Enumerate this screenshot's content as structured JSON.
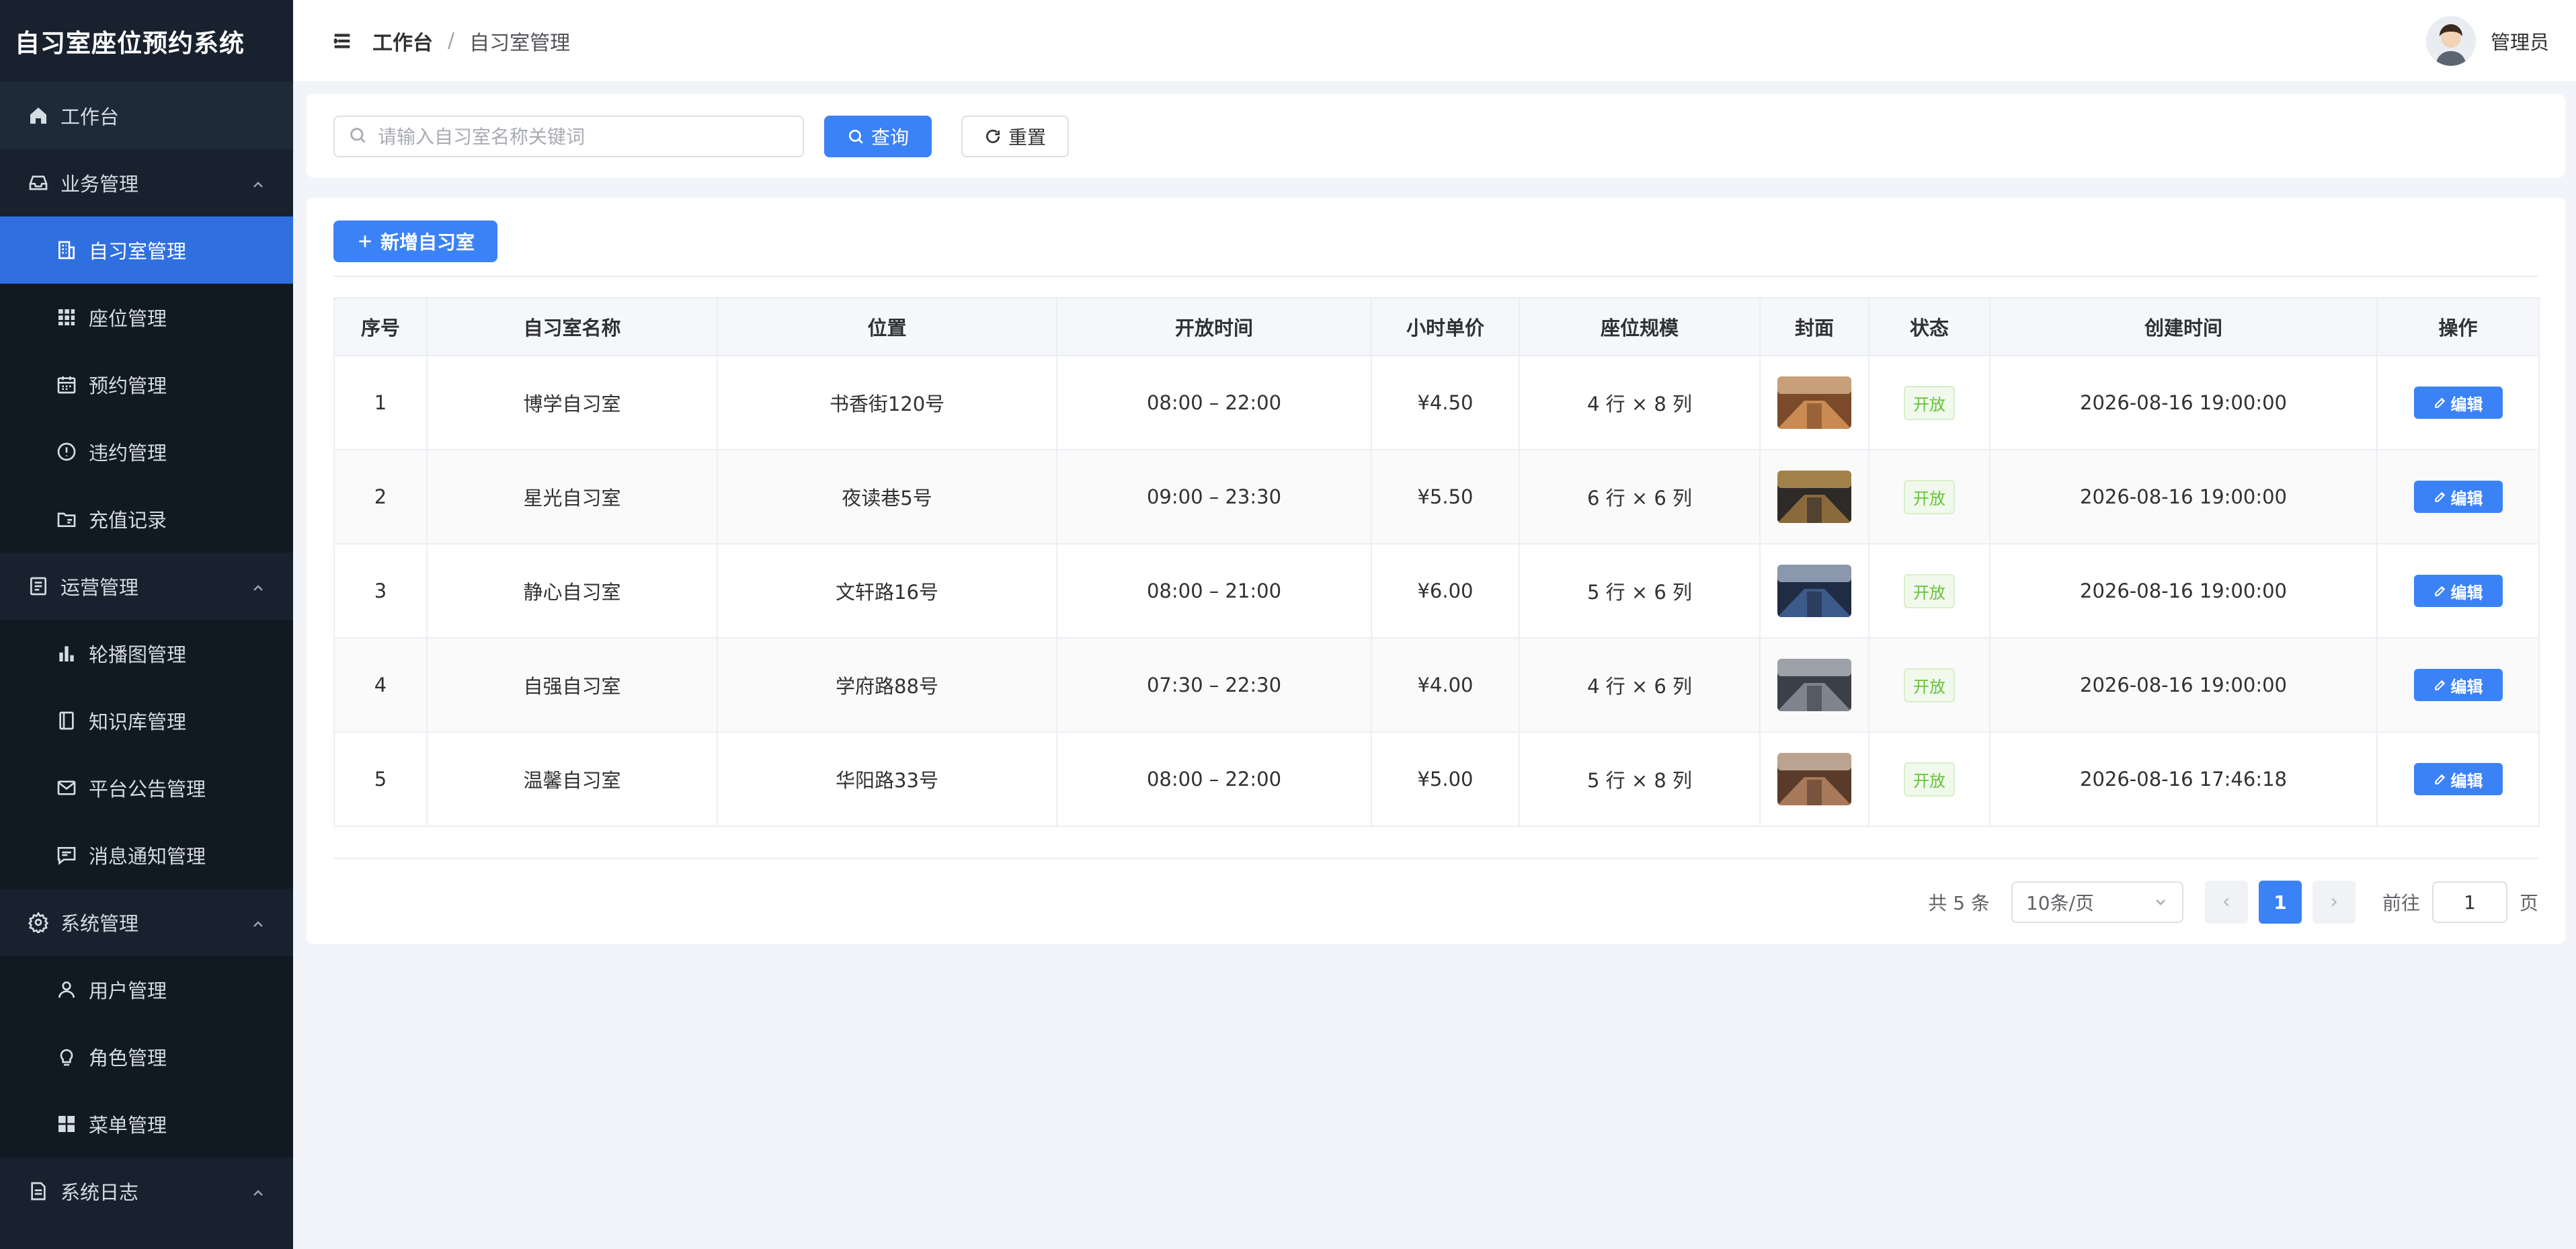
{
  "app": {
    "title": "自习室座位预约系统"
  },
  "sidebar": {
    "home": {
      "label": "工作台",
      "icon": "home-icon"
    },
    "groups": [
      {
        "label": "业务管理",
        "icon": "inbox-icon",
        "items": [
          {
            "label": "自习室管理",
            "icon": "building-icon",
            "active": true
          },
          {
            "label": "座位管理",
            "icon": "grid-icon"
          },
          {
            "label": "预约管理",
            "icon": "calendar-icon"
          },
          {
            "label": "违约管理",
            "icon": "alert-circle-icon"
          },
          {
            "label": "充值记录",
            "icon": "folder-icon"
          }
        ]
      },
      {
        "label": "运营管理",
        "icon": "document-icon",
        "items": [
          {
            "label": "轮播图管理",
            "icon": "bar-chart-icon"
          },
          {
            "label": "知识库管理",
            "icon": "book-icon"
          },
          {
            "label": "平台公告管理",
            "icon": "mail-icon"
          },
          {
            "label": "消息通知管理",
            "icon": "message-icon"
          }
        ]
      },
      {
        "label": "系统管理",
        "icon": "gear-icon",
        "items": [
          {
            "label": "用户管理",
            "icon": "user-icon"
          },
          {
            "label": "角色管理",
            "icon": "bulb-icon"
          },
          {
            "label": "菜单管理",
            "icon": "grid-icon"
          }
        ]
      },
      {
        "label": "系统日志",
        "icon": "file-icon",
        "items": []
      }
    ]
  },
  "header": {
    "breadcrumb": [
      "工作台",
      "自习室管理"
    ],
    "breadcrumb_sep": "/",
    "user_name": "管理员"
  },
  "search": {
    "placeholder": "请输入自习室名称关键词",
    "value": "",
    "query_label": "查询",
    "reset_label": "重置"
  },
  "toolbar": {
    "add_label": "新增自习室"
  },
  "table": {
    "columns": [
      "序号",
      "自习室名称",
      "位置",
      "开放时间",
      "小时单价",
      "座位规模",
      "封面",
      "状态",
      "创建时间",
      "操作"
    ],
    "rows": [
      {
        "no": "1",
        "name": "博学自习室",
        "location": "书香街120号",
        "hours": "08:00 – 22:00",
        "price": "¥4.50",
        "scale": "4 行 × 8 列",
        "status": "开放",
        "created": "2026-08-16 19:00:00",
        "action": "编辑",
        "cover_colors": [
          "#7a4a2a",
          "#c98b52",
          "#e8c39a"
        ]
      },
      {
        "no": "2",
        "name": "星光自习室",
        "location": "夜读巷5号",
        "hours": "09:00 – 23:30",
        "price": "¥5.50",
        "scale": "6 行 × 6 列",
        "status": "开放",
        "created": "2026-08-16 19:00:00",
        "action": "编辑",
        "cover_colors": [
          "#2d2a28",
          "#8a6a3c",
          "#d6a65a"
        ]
      },
      {
        "no": "3",
        "name": "静心自习室",
        "location": "文轩路16号",
        "hours": "08:00 – 21:00",
        "price": "¥6.00",
        "scale": "5 行 × 6 列",
        "status": "开放",
        "created": "2026-08-16 19:00:00",
        "action": "编辑",
        "cover_colors": [
          "#1f2c44",
          "#3c5a8a",
          "#b8c4d8"
        ]
      },
      {
        "no": "4",
        "name": "自强自习室",
        "location": "学府路88号",
        "hours": "07:30 – 22:30",
        "price": "¥4.00",
        "scale": "4 行 × 6 列",
        "status": "开放",
        "created": "2026-08-16 19:00:00",
        "action": "编辑",
        "cover_colors": [
          "#3a3f48",
          "#7e858f",
          "#c7ccd2"
        ]
      },
      {
        "no": "5",
        "name": "温馨自习室",
        "location": "华阳路33号",
        "hours": "08:00 – 22:00",
        "price": "¥5.00",
        "scale": "5 行 × 8 列",
        "status": "开放",
        "created": "2026-08-16 17:46:18",
        "action": "编辑",
        "cover_colors": [
          "#5a3b2a",
          "#a8795a",
          "#e3d0bd"
        ]
      }
    ]
  },
  "pagination": {
    "total_text": "共 5 条",
    "page_size": "10条/页",
    "current_page": "1",
    "goto_prefix": "前往",
    "goto_value": "1",
    "goto_suffix": "页"
  },
  "colors": {
    "primary": "#3b82f6",
    "sidebar_bg": "#18212e",
    "active_menu": "#2f6fe0",
    "tag_success": "#67c23a"
  }
}
